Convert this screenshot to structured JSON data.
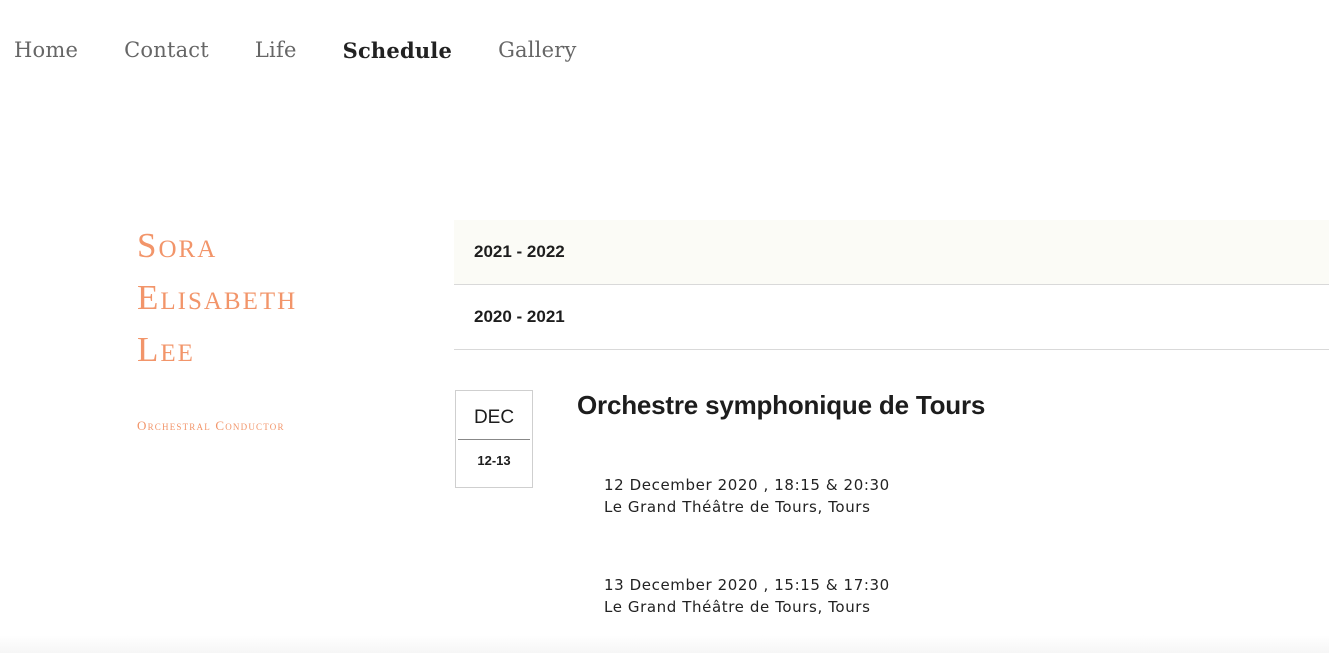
{
  "nav": {
    "items": [
      {
        "label": "Home",
        "active": false
      },
      {
        "label": "Contact",
        "active": false
      },
      {
        "label": "Life",
        "active": false
      },
      {
        "label": "Schedule",
        "active": true
      },
      {
        "label": "Gallery",
        "active": false
      }
    ]
  },
  "brand": {
    "name_lines": [
      "Sora",
      "Elisabeth",
      "Lee"
    ],
    "subtitle": "Orchestral Conductor"
  },
  "seasons": [
    {
      "label": "2021 - 2022",
      "active": true
    },
    {
      "label": "2020 - 2021",
      "active": false
    }
  ],
  "event": {
    "month": "DEC",
    "days": "12-13",
    "title": "Orchestre symphonique de Tours",
    "performances": [
      {
        "when": "12 December 2020 , 18:15 & 20:30",
        "venue": "Le Grand Théâtre de Tours, Tours"
      },
      {
        "when": "13 December 2020 , 15:15 & 17:30",
        "venue": "Le Grand Théâtre de Tours, Tours"
      }
    ]
  },
  "colors": {
    "accent": "#f2956a",
    "active_season_bg": "#fbfbf6",
    "text": "#1d1d1d",
    "nav_inactive": "#666666"
  }
}
